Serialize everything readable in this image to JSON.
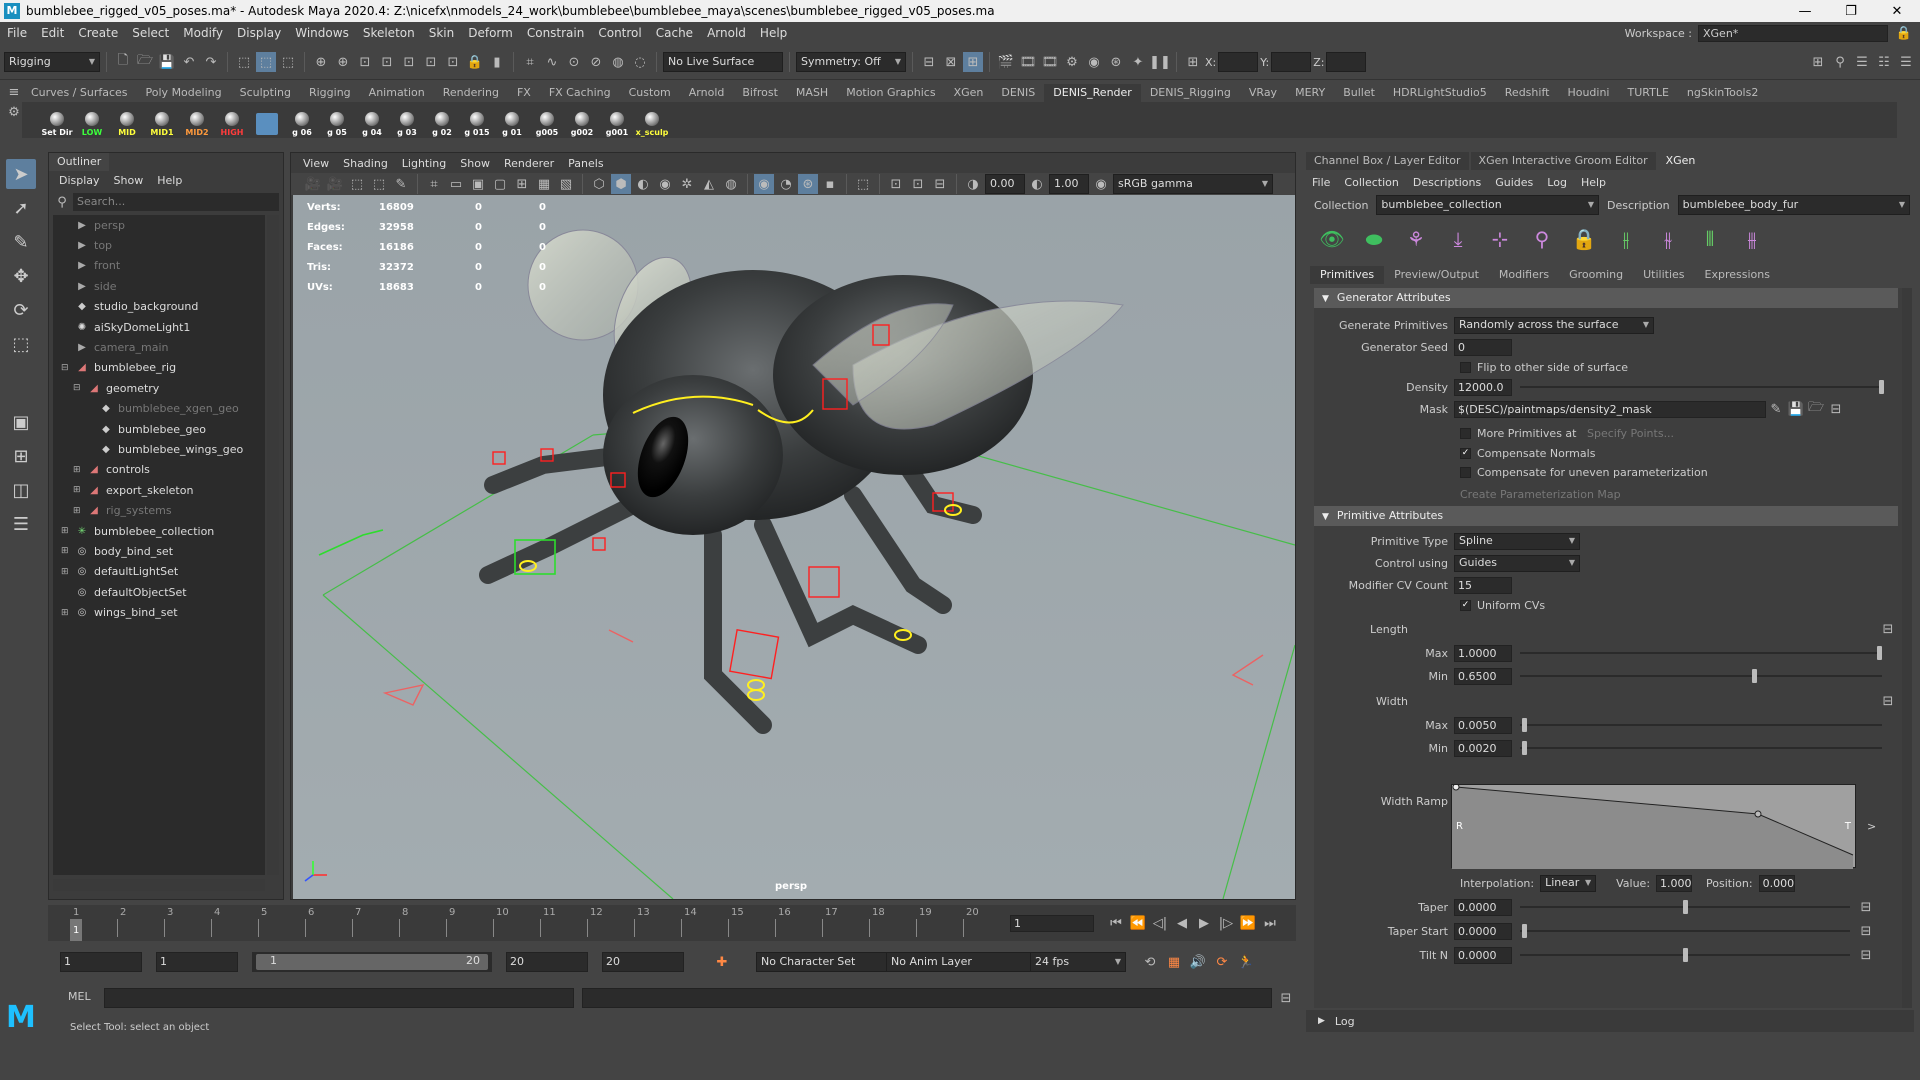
{
  "window": {
    "title": "bumblebee_rigged_v05_poses.ma* - Autodesk Maya 2020.4: Z:\\nicefx\\nmodels_24_work\\bumblebee\\bumblebee_maya\\scenes\\bumblebee_rigged_v05_poses.ma",
    "minimize": "—",
    "restore": "❐",
    "close": "✕"
  },
  "menu": {
    "items": [
      "File",
      "Edit",
      "Create",
      "Select",
      "Modify",
      "Display",
      "Windows",
      "Skeleton",
      "Skin",
      "Deform",
      "Constrain",
      "Control",
      "Cache",
      "Arnold",
      "Help"
    ],
    "workspace_label": "Workspace :",
    "workspace_value": "XGen*"
  },
  "statusline": {
    "mode": "Rigging",
    "live_surface": "No Live Surface",
    "symmetry": "Symmetry: Off",
    "x_label": "X:",
    "y_label": "Y:",
    "z_label": "Z:"
  },
  "shelf": {
    "tabs": [
      "Curves / Surfaces",
      "Poly Modeling",
      "Sculpting",
      "Rigging",
      "Animation",
      "Rendering",
      "FX",
      "FX Caching",
      "Custom",
      "Arnold",
      "Bifrost",
      "MASH",
      "Motion Graphics",
      "XGen",
      "DENIS",
      "DENIS_Render",
      "DENIS_Rigging",
      "VRay",
      "MERY",
      "Bullet",
      "HDRLightStudio5",
      "Redshift",
      "Houdini",
      "TURTLE",
      "ngSkinTools2"
    ],
    "active_tab": "DENIS_Render",
    "buttons": [
      {
        "label": "Set Dir",
        "color": "#ffffff"
      },
      {
        "label": "LOW",
        "color": "#3cff3c"
      },
      {
        "label": "MID",
        "color": "#ffff3c"
      },
      {
        "label": "MID1",
        "color": "#ffff3c"
      },
      {
        "label": "MID2",
        "color": "#ff9a3c"
      },
      {
        "label": "HIGH",
        "color": "#ff3c3c"
      },
      {
        "label": "",
        "color": "#ffffff"
      },
      {
        "label": "g 06",
        "color": "#ffffff"
      },
      {
        "label": "g 05",
        "color": "#ffffff"
      },
      {
        "label": "g 04",
        "color": "#ffffff"
      },
      {
        "label": "g 03",
        "color": "#ffffff"
      },
      {
        "label": "g 02",
        "color": "#ffffff"
      },
      {
        "label": "g 015",
        "color": "#ffffff"
      },
      {
        "label": "g 01",
        "color": "#ffffff"
      },
      {
        "label": "g005",
        "color": "#ffffff"
      },
      {
        "label": "g002",
        "color": "#ffffff"
      },
      {
        "label": "g001",
        "color": "#ffffff"
      },
      {
        "label": "x_sculp",
        "color": "#ffff3c"
      }
    ]
  },
  "outliner": {
    "tab": "Outliner",
    "menu": [
      "Display",
      "Show",
      "Help"
    ],
    "search_placeholder": "Search...",
    "items": [
      {
        "label": "persp",
        "indent": 0,
        "dim": true,
        "icon": "camera-icon",
        "exp": ""
      },
      {
        "label": "top",
        "indent": 0,
        "dim": true,
        "icon": "camera-icon",
        "exp": ""
      },
      {
        "label": "front",
        "indent": 0,
        "dim": true,
        "icon": "camera-icon",
        "exp": ""
      },
      {
        "label": "side",
        "indent": 0,
        "dim": true,
        "icon": "camera-icon",
        "exp": ""
      },
      {
        "label": "studio_background",
        "indent": 0,
        "dim": false,
        "icon": "mesh-icon",
        "exp": ""
      },
      {
        "label": "aiSkyDomeLight1",
        "indent": 0,
        "dim": false,
        "icon": "light-icon",
        "exp": ""
      },
      {
        "label": "camera_main",
        "indent": 0,
        "dim": true,
        "icon": "camera-icon",
        "exp": ""
      },
      {
        "label": "bumblebee_rig",
        "indent": 0,
        "dim": false,
        "icon": "group-icon",
        "exp": "⊟"
      },
      {
        "label": "geometry",
        "indent": 1,
        "dim": false,
        "icon": "group-icon",
        "exp": "⊟"
      },
      {
        "label": "bumblebee_xgen_geo",
        "indent": 2,
        "dim": true,
        "icon": "mesh-icon",
        "exp": ""
      },
      {
        "label": "bumblebee_geo",
        "indent": 2,
        "dim": false,
        "icon": "mesh-icon",
        "exp": ""
      },
      {
        "label": "bumblebee_wings_geo",
        "indent": 2,
        "dim": false,
        "icon": "mesh-icon",
        "exp": ""
      },
      {
        "label": "controls",
        "indent": 1,
        "dim": false,
        "icon": "group-icon",
        "exp": "⊞"
      },
      {
        "label": "export_skeleton",
        "indent": 1,
        "dim": false,
        "icon": "group-icon",
        "exp": "⊞"
      },
      {
        "label": "rig_systems",
        "indent": 1,
        "dim": true,
        "icon": "group-icon",
        "exp": "⊞"
      },
      {
        "label": "bumblebee_collection",
        "indent": 0,
        "dim": false,
        "icon": "xgen-icon",
        "exp": "⊞"
      },
      {
        "label": "body_bind_set",
        "indent": 0,
        "dim": false,
        "icon": "set-icon",
        "exp": "⊞"
      },
      {
        "label": "defaultLightSet",
        "indent": 0,
        "dim": false,
        "icon": "set-icon",
        "exp": "⊞"
      },
      {
        "label": "defaultObjectSet",
        "indent": 0,
        "dim": false,
        "icon": "set-icon",
        "exp": ""
      },
      {
        "label": "wings_bind_set",
        "indent": 0,
        "dim": false,
        "icon": "set-icon",
        "exp": "⊞"
      }
    ]
  },
  "viewport": {
    "menu": [
      "View",
      "Shading",
      "Lighting",
      "Show",
      "Renderer",
      "Panels"
    ],
    "exposure": "0.00",
    "gamma": "1.00",
    "colorspace": "sRGB gamma",
    "camera_label": "persp",
    "hud": [
      {
        "label": "Verts:",
        "v": "16809",
        "a": "0",
        "b": "0"
      },
      {
        "label": "Edges:",
        "v": "32958",
        "a": "0",
        "b": "0"
      },
      {
        "label": "Faces:",
        "v": "16186",
        "a": "0",
        "b": "0"
      },
      {
        "label": "Tris:",
        "v": "32372",
        "a": "0",
        "b": "0"
      },
      {
        "label": "UVs:",
        "v": "18683",
        "a": "0",
        "b": "0"
      }
    ]
  },
  "rightpanel": {
    "tabs": [
      "Channel Box / Layer Editor",
      "XGen Interactive Groom Editor",
      "XGen"
    ],
    "active_tab": "XGen",
    "menu": [
      "File",
      "Collection",
      "Descriptions",
      "Guides",
      "Log",
      "Help"
    ],
    "collection_label": "Collection",
    "collection_value": "bumblebee_collection",
    "description_label": "Description",
    "description_value": "bumblebee_body_fur",
    "subtabs": [
      "Primitives",
      "Preview/Output",
      "Modifiers",
      "Grooming",
      "Utilities",
      "Expressions"
    ],
    "active_subtab": "Primitives",
    "generator": {
      "title": "Generator Attributes",
      "generate_label": "Generate Primitives",
      "generate_value": "Randomly across the surface",
      "seed_label": "Generator Seed",
      "seed_value": "0",
      "flip_label": "Flip to other side of surface",
      "density_label": "Density",
      "density_value": "12000.0",
      "mask_label": "Mask",
      "mask_value": "$(DESC)/paintmaps/density2_mask",
      "more_label": "More Primitives at",
      "specify_label": "Specify Points...",
      "compnorm_label": "Compensate Normals",
      "compparam_label": "Compensate for uneven parameterization",
      "create_map_label": "Create Parameterization Map"
    },
    "primitive": {
      "title": "Primitive Attributes",
      "type_label": "Primitive Type",
      "type_value": "Spline",
      "control_label": "Control using",
      "control_value": "Guides",
      "cv_label": "Modifier CV Count",
      "cv_value": "15",
      "uniform_label": "Uniform CVs",
      "length_label": "Length",
      "len_max_label": "Max",
      "len_max_value": "1.0000",
      "len_max_level": 1.0,
      "len_min_label": "Min",
      "len_min_value": "0.6500",
      "len_min_level": 0.65,
      "width_label": "Width",
      "w_max_label": "Max",
      "w_max_value": "0.0050",
      "w_min_label": "Min",
      "w_min_value": "0.0020",
      "ramp_label": "Width Ramp",
      "ramp_left": "R",
      "ramp_right": "T",
      "interp_label": "Interpolation:",
      "interp_value": "Linear",
      "value_label": "Value:",
      "value_value": "1.000",
      "position_label": "Position:",
      "position_value": "0.000",
      "taper_label": "Taper",
      "taper_value": "0.0000",
      "taperstart_label": "Taper Start",
      "taperstart_value": "0.0000",
      "tiltn_label": "Tilt N",
      "tiltn_value": "0.0000"
    },
    "log_label": "Log"
  },
  "timeline": {
    "ticks": [
      "1",
      "2",
      "3",
      "4",
      "5",
      "6",
      "7",
      "8",
      "9",
      "10",
      "11",
      "12",
      "13",
      "14",
      "15",
      "16",
      "17",
      "18",
      "19",
      "20"
    ],
    "current_frame": "1",
    "range_start": "1",
    "range_inner_start": "1",
    "slider_left": "1",
    "slider_right": "20",
    "range_inner_end": "20",
    "range_end": "20",
    "character_set": "No Character Set",
    "anim_layer": "No Anim Layer",
    "fps": "24 fps"
  },
  "cmd": {
    "mel_label": "MEL",
    "help": "Select Tool: select an object"
  }
}
